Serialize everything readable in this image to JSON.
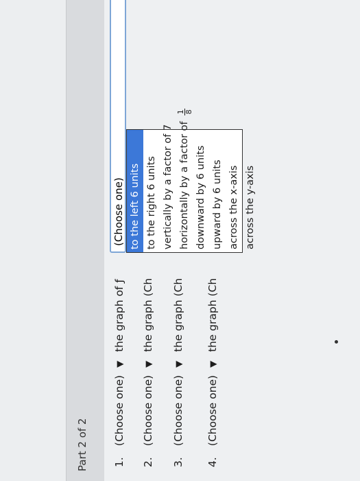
{
  "header": {
    "title": "Part 2 of 2"
  },
  "rows": [
    {
      "number": "1.",
      "select": "(Choose one)",
      "text": "the graph of ƒ"
    },
    {
      "number": "2.",
      "select": "(Choose one)",
      "text": "the graph"
    },
    {
      "number": "3.",
      "select": "(Choose one)",
      "text": "the graph"
    },
    {
      "number": "4.",
      "select": "(Choose one)",
      "text": "the graph"
    }
  ],
  "row_suffix": "(Ch",
  "dropdown": {
    "current": "(Choose one)",
    "options": [
      "to the left 6 units",
      "to the right 6 units",
      "vertically by a factor of 7",
      "horizontally by a factor of",
      "downward by 6 units",
      "upward by 6 units",
      "across the x-axis",
      "across the y-axis"
    ],
    "highlighted_index": 0,
    "fraction": {
      "numerator": "1",
      "denominator": "8"
    }
  },
  "colors": {
    "highlight": "#3c78d8",
    "focus_border": "#7ea6d6"
  },
  "icons": {
    "caret": "triangle-down-icon"
  }
}
